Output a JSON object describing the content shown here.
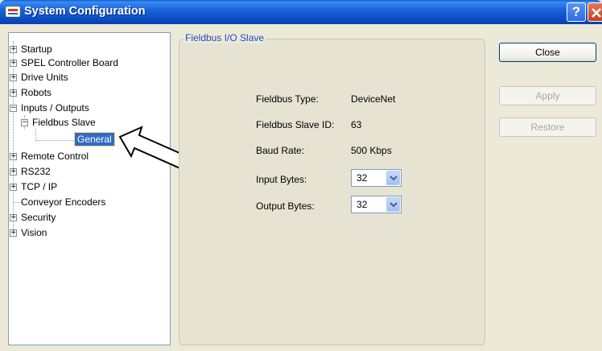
{
  "window": {
    "title": "System Configuration",
    "help_label": "?"
  },
  "tree": {
    "items": [
      {
        "label": "Startup"
      },
      {
        "label": "SPEL Controller Board"
      },
      {
        "label": "Drive Units"
      },
      {
        "label": "Robots"
      },
      {
        "label": "Inputs / Outputs"
      },
      {
        "label": "Fieldbus Slave"
      },
      {
        "label": "General"
      },
      {
        "label": "Remote Control"
      },
      {
        "label": "RS232"
      },
      {
        "label": "TCP / IP"
      },
      {
        "label": "Conveyor Encoders"
      },
      {
        "label": "Security"
      },
      {
        "label": "Vision"
      }
    ],
    "selected": "General"
  },
  "group": {
    "title": "Fieldbus I/O Slave",
    "fields": {
      "type_label": "Fieldbus Type:",
      "type_value": "DeviceNet",
      "id_label": "Fieldbus Slave ID:",
      "id_value": "63",
      "baud_label": "Baud Rate:",
      "baud_value": "500 Kbps",
      "input_label": "Input Bytes:",
      "input_value": "32",
      "output_label": "Output Bytes:",
      "output_value": "32"
    }
  },
  "buttons": {
    "close": "Close",
    "apply": "Apply",
    "restore": "Restore"
  },
  "icons": {
    "app": "app-window-icon",
    "pointer": "arrow-pointer-icon",
    "dropdown": "chevron-down-icon"
  },
  "colors": {
    "titlebar": "#0b4fc7",
    "selection": "#316ac5",
    "group_title": "#1f4cc4",
    "dialog_bg": "#ece9d8"
  }
}
